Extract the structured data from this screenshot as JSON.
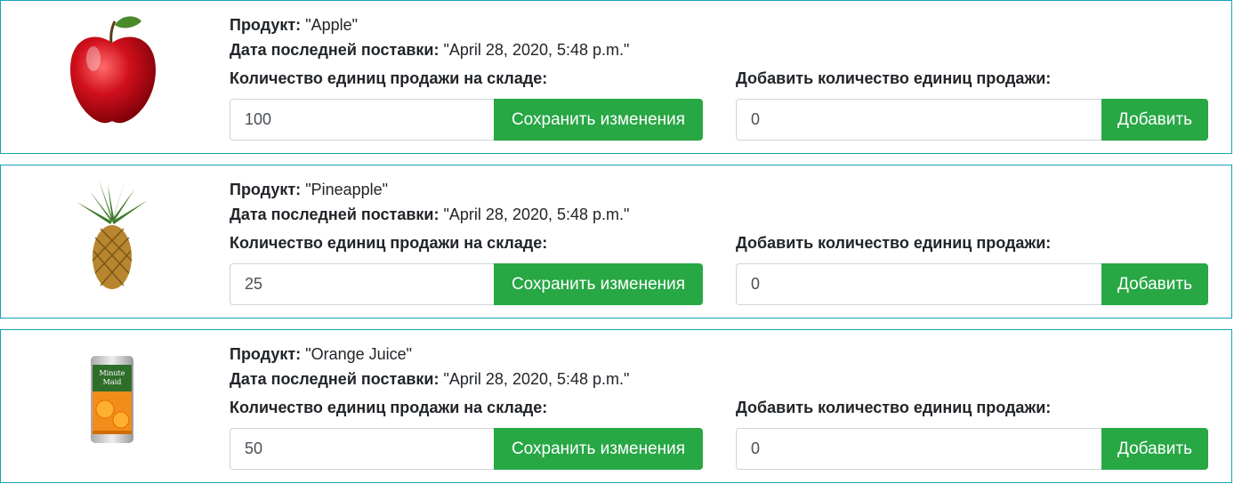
{
  "labels": {
    "product": "Продукт:",
    "last_delivery": "Дата последней поставки:",
    "stock_qty": "Количество единиц продажи на складе:",
    "add_qty": "Добавить количество единиц продажи:",
    "save_button": "Сохранить изменения",
    "add_button": "Добавить"
  },
  "products": [
    {
      "name": "\"Apple\"",
      "date": "\"April 28, 2020, 5:48 p.m.\"",
      "stock": "100",
      "add": "0",
      "icon": "apple-image"
    },
    {
      "name": "\"Pineapple\"",
      "date": "\"April 28, 2020, 5:48 p.m.\"",
      "stock": "25",
      "add": "0",
      "icon": "pineapple-image"
    },
    {
      "name": "\"Orange Juice\"",
      "date": "\"April 28, 2020, 5:48 p.m.\"",
      "stock": "50",
      "add": "0",
      "icon": "orange-juice-can-image",
      "can_text": [
        "Minute",
        "Maid"
      ]
    }
  ],
  "colors": {
    "card_border": "#17a2b8",
    "button": "#28a745"
  }
}
